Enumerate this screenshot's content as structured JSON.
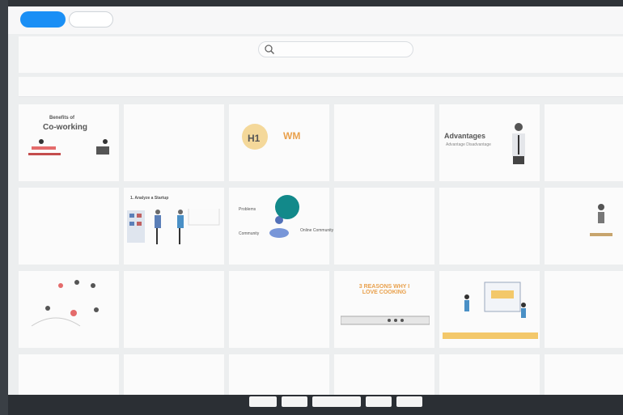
{
  "thumbnails": {
    "t1": {
      "line1": "Benefits of",
      "line2": "Co-working"
    },
    "t3": {
      "badge": "H1",
      "title": "WM"
    },
    "t5": {
      "title": "Advantages",
      "sub": "Advantage Disadvantage"
    },
    "t8": {
      "title": "1. Analyze a Startup"
    },
    "t9": {
      "left": "Problems",
      "bottom": "Community",
      "right": "Online Community"
    },
    "t16": {
      "title": "3 REASONS WHY I LOVE COOKING"
    }
  },
  "colors": {
    "primary": "#1a8ff5",
    "cursor": "#12898a",
    "accent": "#e9a04b"
  }
}
